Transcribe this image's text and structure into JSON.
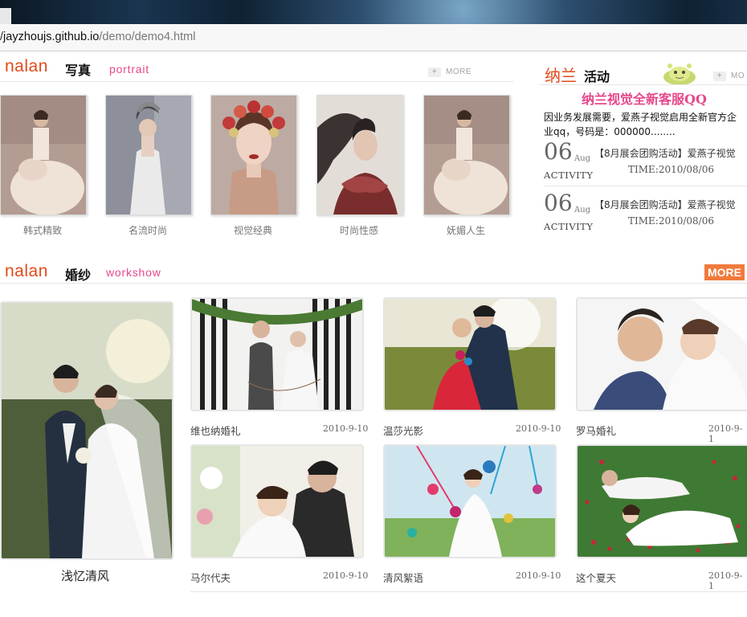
{
  "browser": {
    "url_host": "jayzhoujs.github.io",
    "url_path": "/demo/demo4.html",
    "url_prefix": "/"
  },
  "portrait": {
    "logo": "nalan",
    "title_cn": "写真",
    "title_en": "portrait",
    "more": "MORE",
    "items": [
      {
        "caption": "韩式精致"
      },
      {
        "caption": "名流时尚"
      },
      {
        "caption": "视觉经典"
      },
      {
        "caption": "时尚性感"
      },
      {
        "caption": "妩媚人生"
      }
    ]
  },
  "activity": {
    "title_brand": "纳兰",
    "title_cn": "活动",
    "more": "MO",
    "headline": "纳兰视觉全新客服QQ",
    "intro": "因业务发展需要，爱燕子视觉启用全新官方企业qq，号码是：000000........",
    "entries": [
      {
        "day": "06",
        "month": "Aug",
        "label": "ACTIVITY",
        "title": "【8月展会团购活动】爱燕子视觉",
        "time": "TIME:2010/08/06"
      },
      {
        "day": "06",
        "month": "Aug",
        "label": "ACTIVITY",
        "title": "【8月展会团购活动】爱燕子视觉",
        "time": "TIME:2010/08/06"
      }
    ]
  },
  "wedding": {
    "logo": "nalan",
    "title_cn": "婚纱",
    "title_en": "workshow",
    "more": "MORE",
    "featured_caption": "浅忆清风",
    "cards": [
      {
        "title": "维也纳婚礼",
        "date": "2010-9-10"
      },
      {
        "title": "温莎光影",
        "date": "2010-9-10"
      },
      {
        "title": "罗马婚礼",
        "date": "2010-9-1"
      },
      {
        "title": "马尔代夫",
        "date": "2010-9-10"
      },
      {
        "title": "清风絮语",
        "date": "2010-9-10"
      },
      {
        "title": "这个夏天",
        "date": "2010-9-1"
      }
    ]
  },
  "colors": {
    "accent_orange": "#e24a1a",
    "accent_pink": "#e7478b",
    "more_button": "#f07a3c"
  }
}
